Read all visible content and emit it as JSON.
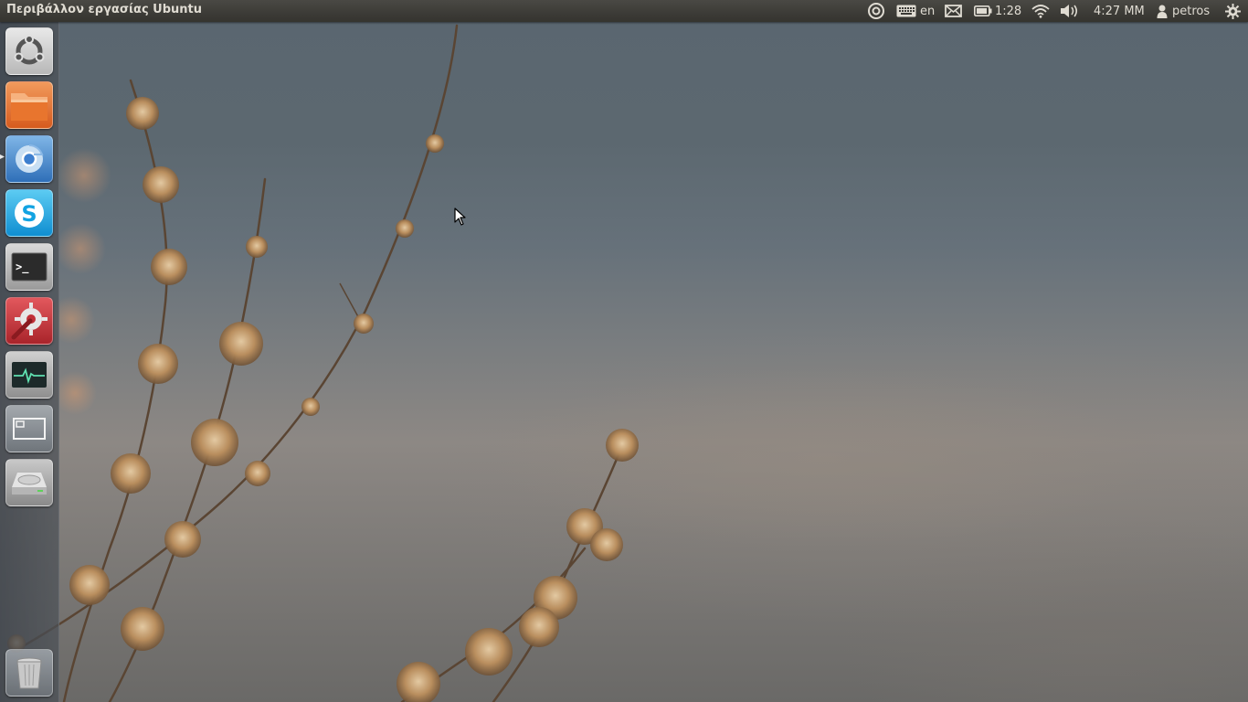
{
  "panel": {
    "window_title": "Περιβάλλον εργασίας Ubuntu",
    "keyboard_layout": "en",
    "battery_time": "1:28",
    "clock": "4:27 ΜΜ",
    "username": "petros"
  },
  "launcher": {
    "items": [
      {
        "name": "Dash home",
        "icon": "ubuntu-logo-icon"
      },
      {
        "name": "Files",
        "icon": "folder-icon"
      },
      {
        "name": "Chromium",
        "icon": "chromium-icon",
        "running": true
      },
      {
        "name": "Skype",
        "icon": "skype-icon",
        "glyph_text": "S"
      },
      {
        "name": "Terminal",
        "icon": "terminal-icon",
        "glyph_text": ">_"
      },
      {
        "name": "System Settings",
        "icon": "settings-icon"
      },
      {
        "name": "System Monitor",
        "icon": "system-monitor-icon"
      },
      {
        "name": "Workspace Switcher",
        "icon": "workspace-switcher-icon"
      },
      {
        "name": "Disk",
        "icon": "hard-drive-icon"
      },
      {
        "name": "Trash",
        "icon": "trash-icon"
      }
    ]
  },
  "colors": {
    "panel_bg": "#3c3b37",
    "panel_text": "#dfdbd2",
    "files_orange": "#e26a2c",
    "settings_red": "#c7343a",
    "skype_blue": "#1aa5e6"
  }
}
